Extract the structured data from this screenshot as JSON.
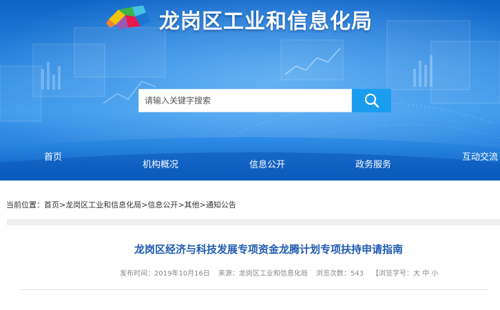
{
  "header": {
    "site_title": "龙岗区工业和信息化局",
    "logo_icon": "colorful-leaf-logo-icon"
  },
  "search": {
    "placeholder": "请输入关键字搜索",
    "button_icon": "search-icon"
  },
  "nav": {
    "items": [
      {
        "label": "首页"
      },
      {
        "label": "机构概况"
      },
      {
        "label": "信息公开"
      },
      {
        "label": "政务服务"
      },
      {
        "label": "互动交流"
      }
    ]
  },
  "breadcrumb": {
    "prefix": "当前位置：",
    "items": [
      "首页",
      "龙岗区工业和信息化局",
      "信息公开",
      "其他",
      "通知公告"
    ],
    "separator": ">"
  },
  "article": {
    "title": "龙岗区经济与科技发展专项资金龙腾计划专项扶持申请指南",
    "published_label": "发布时间：",
    "published_date": "2019年10月16日",
    "source_label": "来源：",
    "source": "龙岗区工业和信息化局",
    "views_label": "浏览次数：",
    "views": "543",
    "font_size_label": "【浏览字号：",
    "font_large": "大",
    "font_medium": "中",
    "font_small": "小"
  },
  "colors": {
    "banner_blue": "#1f7fdc",
    "search_button": "#1a9df0",
    "title_blue": "#1f5bb0"
  }
}
